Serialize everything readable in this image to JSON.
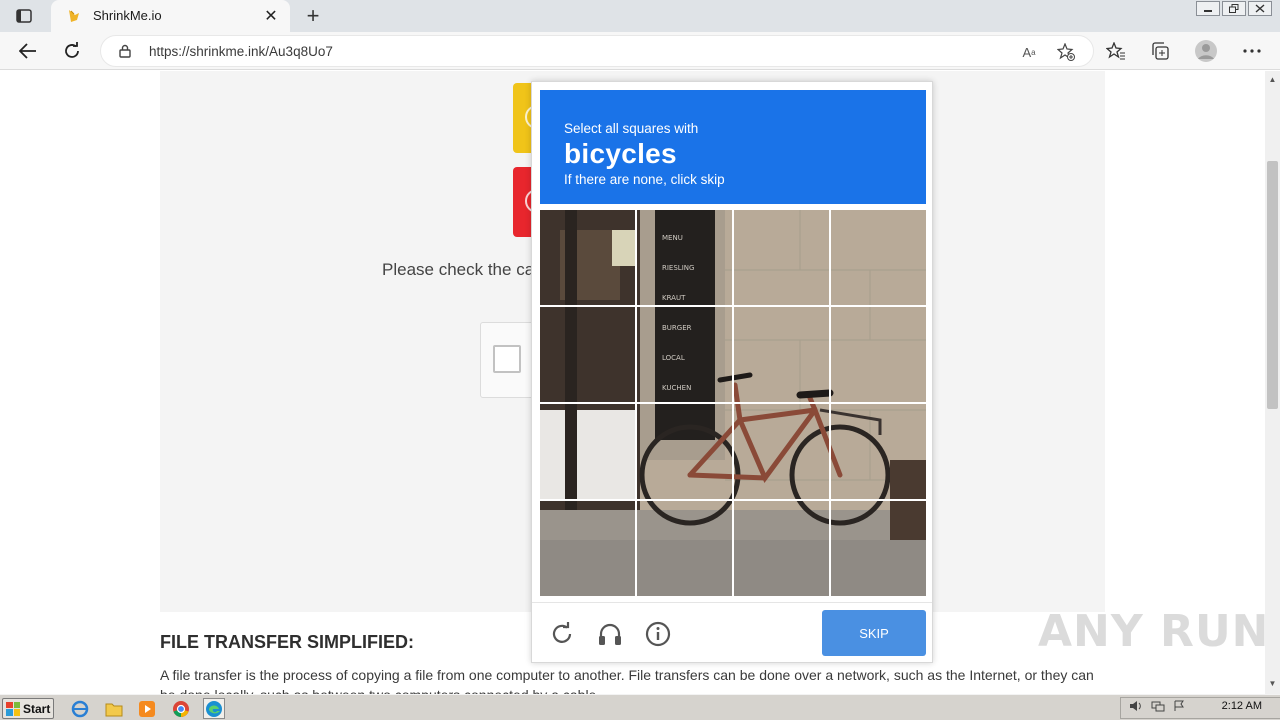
{
  "browser": {
    "tab_title": "ShrinkMe.io",
    "tab_close": "✕",
    "new_tab": "+",
    "url": "https://shrinkme.ink/Au3q8Uo7"
  },
  "page": {
    "check_text": "Please check the ca",
    "section_heading": "FILE TRANSFER SIMPLIFIED:",
    "section_body": "A file transfer is the process of copying a file from one computer to another. File transfers can be done over a network, such as the Internet, or they can be done locally, such as between two computers connected by a cable."
  },
  "captcha": {
    "prompt_line1": "Select all squares with",
    "target": "bicycles",
    "prompt_line3": "If there are none, click skip",
    "grid_rows": 4,
    "grid_cols": 4,
    "skip_label": "SKIP",
    "accent_color": "#1a73e8",
    "button_color": "#4a90e2"
  },
  "watermark": "ANY RUN",
  "taskbar": {
    "start_label": "Start",
    "clock": "2:12 AM"
  },
  "icons": [
    "tab-actions-icon",
    "favicon-icon",
    "back-icon",
    "refresh-icon",
    "lock-icon",
    "read-aloud-icon",
    "add-favorite-icon",
    "favorites-icon",
    "collections-icon",
    "profile-icon",
    "more-icon",
    "reload-challenge-icon",
    "audio-challenge-icon",
    "info-icon",
    "ie-icon",
    "folder-icon",
    "media-icon",
    "chrome-icon",
    "edge-icon"
  ]
}
